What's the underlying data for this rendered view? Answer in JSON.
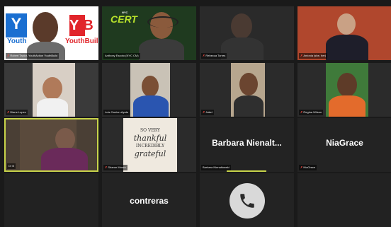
{
  "participants": [
    {
      "name": "Robert Taylor, YouthAction YouthBuild",
      "logo_left": "Y",
      "logo_left_word": "Youth",
      "logo_right": "Y B",
      "logo_right_word": "YouthBuild"
    },
    {
      "name": "Anthony Escoto (NYC CM)",
      "logo_main": "CERT",
      "logo_sub": "NYC"
    },
    {
      "name": "Rebecca Torres"
    },
    {
      "name": "Antonia (she, her)"
    },
    {
      "name": "Diane Lopez"
    },
    {
      "name": "Luis Carrion-Ayala"
    },
    {
      "name": "Jakel"
    },
    {
      "name": "Regina Wilson"
    },
    {
      "name": "Dr B"
    },
    {
      "name": "Sharon Moore",
      "sign_line1": "SO VERY",
      "sign_line2": "thankful",
      "sign_line3": "INCREDIBLY",
      "sign_line4": "grateful"
    },
    {
      "name": "Barbara Nienaltowski",
      "display_name": "Barbara  Nienalt..."
    },
    {
      "name": "NiaGrace",
      "display_name": "NiaGrace"
    },
    {
      "name": "",
      "display_name": ""
    },
    {
      "name": "",
      "display_name": "contreras"
    },
    {
      "name": "",
      "icon": "phone-icon"
    },
    {
      "name": ""
    }
  ],
  "colors": {
    "active_speaker": "#c8d44a",
    "muted": "#e5483f",
    "youth_blue": "#1a6fd1",
    "youthbuild_red": "#e1252b",
    "cert_green": "#b8e22b"
  }
}
